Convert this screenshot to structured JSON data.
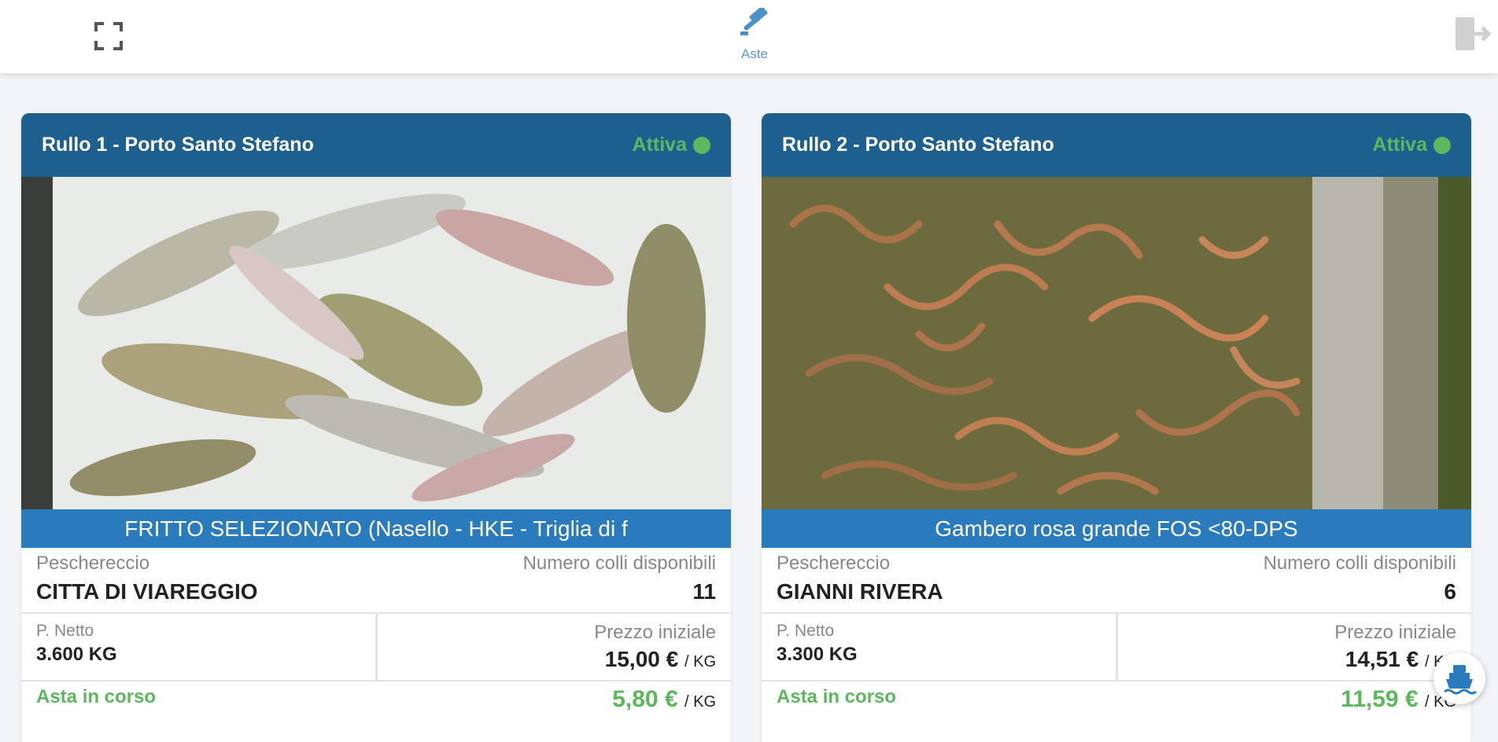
{
  "topbar": {
    "fullscreen_icon": "fullscreen-icon",
    "nav_aste_label": "Aste",
    "nav_aste_icon": "gavel-icon",
    "logout_icon": "logout-icon"
  },
  "colors": {
    "header": "#1d5f8f",
    "product_bar": "#2a7bbd",
    "status_green": "#5cb85c",
    "nav_blue": "#5b98cf"
  },
  "cards": [
    {
      "title": "Rullo 1 - Porto Santo Stefano",
      "status": "Attiva",
      "product": "FRITTO SELEZIONATO (Nasello - HKE - Triglia di f",
      "peschereccio_label": "Peschereccio",
      "peschereccio": "CITTA DI VIAREGGIO",
      "colli_label": "Numero colli disponibili",
      "colli": "11",
      "netto_label": "P. Netto",
      "netto": "3.600 KG",
      "prezzo_label": "Prezzo iniziale",
      "prezzo": "15,00 €",
      "prezzo_unit": "/ KG",
      "asta_label": "Asta in corso",
      "asta_price": "5,80 €",
      "asta_unit": "/ KG"
    },
    {
      "title": "Rullo 2 - Porto Santo Stefano",
      "status": "Attiva",
      "product": "Gambero rosa grande FOS <80-DPS",
      "peschereccio_label": "Peschereccio",
      "peschereccio": "GIANNI RIVERA",
      "colli_label": "Numero colli disponibili",
      "colli": "6",
      "netto_label": "P. Netto",
      "netto": "3.300 KG",
      "prezzo_label": "Prezzo iniziale",
      "prezzo": "14,51 €",
      "prezzo_unit": "/ KG",
      "asta_label": "Asta in corso",
      "asta_price": "11,59 €",
      "asta_unit": "/ KG"
    }
  ],
  "fab_icon": "ship-icon"
}
